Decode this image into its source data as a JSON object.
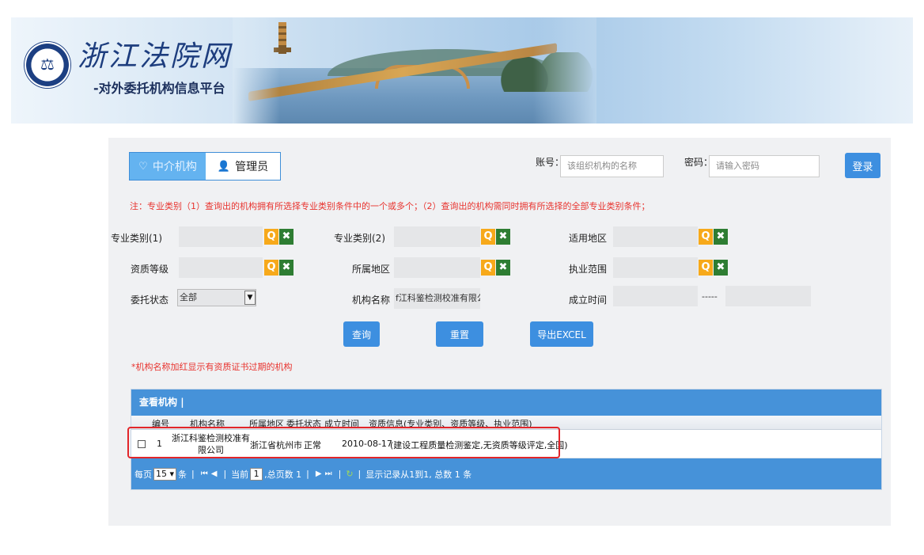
{
  "header": {
    "site_title": "浙江法院网",
    "site_subtitle": "-对外委托机构信息平台"
  },
  "tabs": [
    {
      "label": "中介机构",
      "icon": "heart-eye-icon",
      "active": true
    },
    {
      "label": "管理员",
      "icon": "user-icon",
      "active": false
    }
  ],
  "login": {
    "account_label": "账号：",
    "account_placeholder": "该组织机构的名称",
    "password_label": "密码：",
    "password_placeholder": "请输入密码",
    "login_button": "登录"
  },
  "note": "注：专业类别（1）查询出的机构拥有所选择专业类别条件中的一个或多个；（2）查询出的机构需同时拥有所选择的全部专业类别条件；",
  "filters": {
    "category1_label": "专业类别(1)",
    "category1_value": "",
    "category2_label": "专业类别(2)",
    "category2_value": "",
    "region_label": "适用地区",
    "region_value": "",
    "qualification_label": "资质等级",
    "qualification_value": "",
    "location_label": "所属地区",
    "location_value": "",
    "practice_label": "执业范围",
    "practice_value": "",
    "status_label": "委托状态",
    "status_value": "全部",
    "name_label": "机构名称",
    "name_value": "f江科鉴检测校准有限公司",
    "established_label": "成立时间",
    "established_from": "",
    "established_sep": "-----",
    "established_to": ""
  },
  "buttons": {
    "search": "查询",
    "reset": "重置",
    "export": "导出EXCEL"
  },
  "hint": "*机构名称加红显示有资质证书过期的机构",
  "grid": {
    "title": "查看机构",
    "columns": [
      "编号",
      "机构名称",
      "所属地区",
      "委托状态",
      "成立时间",
      "资质信息(专业类别、资质等级、执业范围)"
    ],
    "rows": [
      {
        "no": "1",
        "name_line1": "浙江科鉴检测校准有",
        "name_line2": "限公司",
        "region": "浙江省杭州市",
        "status": "正常",
        "date": "2010-08-17",
        "qualification": "(建设工程质量检测鉴定,无资质等级评定,全国)"
      }
    ],
    "pager": {
      "per_page_label": "每页",
      "per_page_value": "15",
      "per_page_unit": "条",
      "current_label": "当前",
      "current_value": "1",
      "total_pages_text": ",总页数 1",
      "records_text": "显示记录从1到1, 总数 1 条"
    }
  },
  "colors": {
    "accent_blue": "#3d8fe0",
    "grid_blue": "#4692d9",
    "search_orange": "#f7a91b",
    "clear_green": "#2e7d32",
    "warning_red": "#e8332e"
  }
}
